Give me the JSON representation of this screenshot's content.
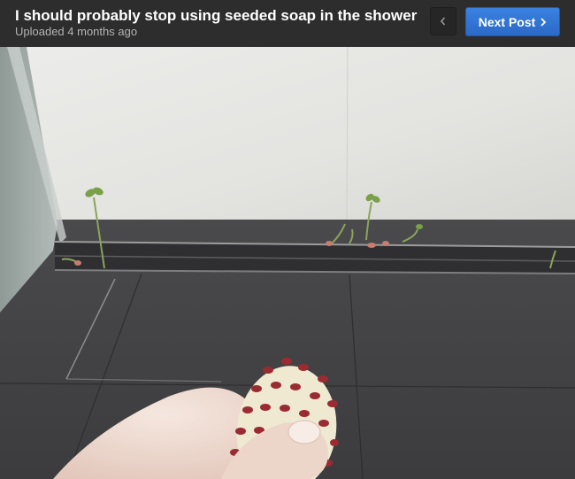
{
  "post": {
    "title": "I should probably stop using seeded soap in the shower",
    "meta": "Uploaded 4 months ago"
  },
  "nav": {
    "prev_icon": "chevron-left-icon",
    "next_label": "Next Post",
    "next_icon": "chevron-right-icon"
  },
  "colors": {
    "header_bg": "#2d2d2e",
    "next_button": "#2f72d6"
  }
}
